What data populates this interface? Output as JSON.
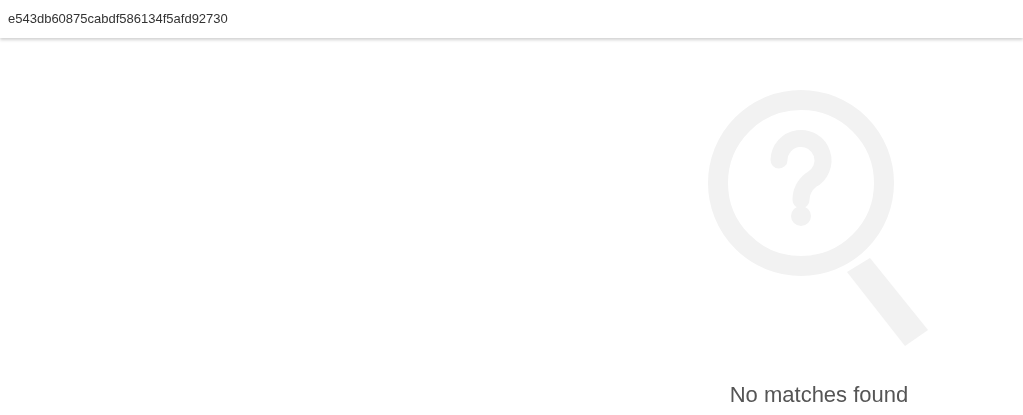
{
  "header": {
    "title": "e543db60875cabdf586134f5afd92730"
  },
  "empty_state": {
    "message": "No matches found"
  }
}
